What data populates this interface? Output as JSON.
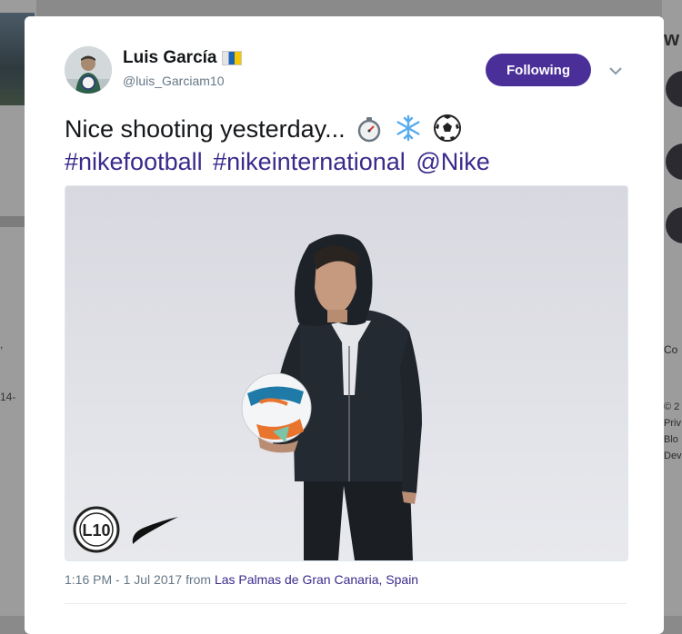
{
  "background": {
    "left_lines": [
      ",",
      "14-"
    ],
    "right_lines": [
      "w",
      "Co",
      "© 2",
      "Priv",
      "Blo",
      "Dev"
    ]
  },
  "tweet": {
    "display_name": "Luis García",
    "handle": "@luis_Garciam10",
    "follow_button": "Following",
    "text": "Nice shooting yesterday...",
    "hashtags": [
      "#nikefootball",
      "#nikeinternational",
      "@Nike"
    ],
    "time": "1:16 PM - 1 Jul 2017",
    "from_label": "from",
    "location": "Las Palmas de Gran Canaria, Spain",
    "emojis": [
      "stopwatch-icon",
      "snowflake-icon",
      "soccer-ball-icon"
    ]
  },
  "colors": {
    "accent": "#4a2f99",
    "link": "#3b2a8c",
    "muted": "#657786",
    "text": "#14171a"
  }
}
